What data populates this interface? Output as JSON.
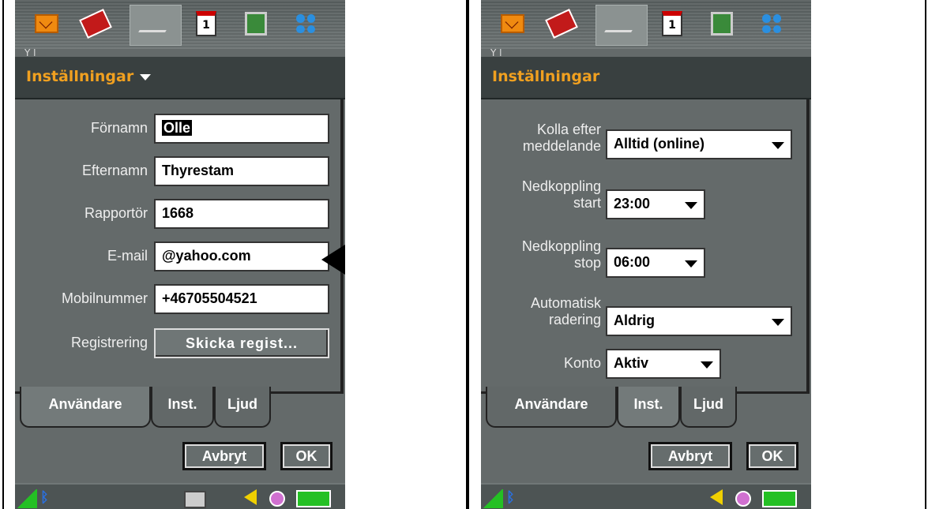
{
  "left": {
    "title": "Inställningar",
    "partial_text": "Y l",
    "fields": [
      {
        "label": "Förnamn",
        "value": "Olle"
      },
      {
        "label": "Efternamn",
        "value": "Thyrestam"
      },
      {
        "label": "Rapportör",
        "value": "1668"
      },
      {
        "label": "E-mail",
        "value": "@yahoo.com"
      },
      {
        "label": "Mobilnummer",
        "value": "+46705504521"
      },
      {
        "label": "Registrering",
        "value": "Skicka regist..."
      }
    ],
    "tabs": [
      "Användare",
      "Inst.",
      "Ljud"
    ],
    "cancel": "Avbryt",
    "ok": "OK"
  },
  "right": {
    "title": "Inställningar",
    "partial_text": "Y l",
    "rows": [
      {
        "label1": "Kolla efter",
        "label2": "meddelande",
        "value": "Alltid (online)"
      },
      {
        "label1": "Nedkoppling",
        "label2": "start",
        "value": "23:00"
      },
      {
        "label1": "Nedkoppling",
        "label2": "stop",
        "value": "06:00"
      },
      {
        "label1": "Automatisk",
        "label2": "radering",
        "value": "Aldrig"
      },
      {
        "label1": "",
        "label2": "Konto",
        "value": "Aktiv"
      }
    ],
    "tabs": [
      "Användare",
      "Inst.",
      "Ljud"
    ],
    "cancel": "Avbryt",
    "ok": "OK"
  },
  "calendar_day": "1",
  "bluetooth_glyph": "ᛒ",
  "colors": {
    "title": "#f0a020",
    "background": "#646a6a",
    "battery": "#24c024"
  }
}
